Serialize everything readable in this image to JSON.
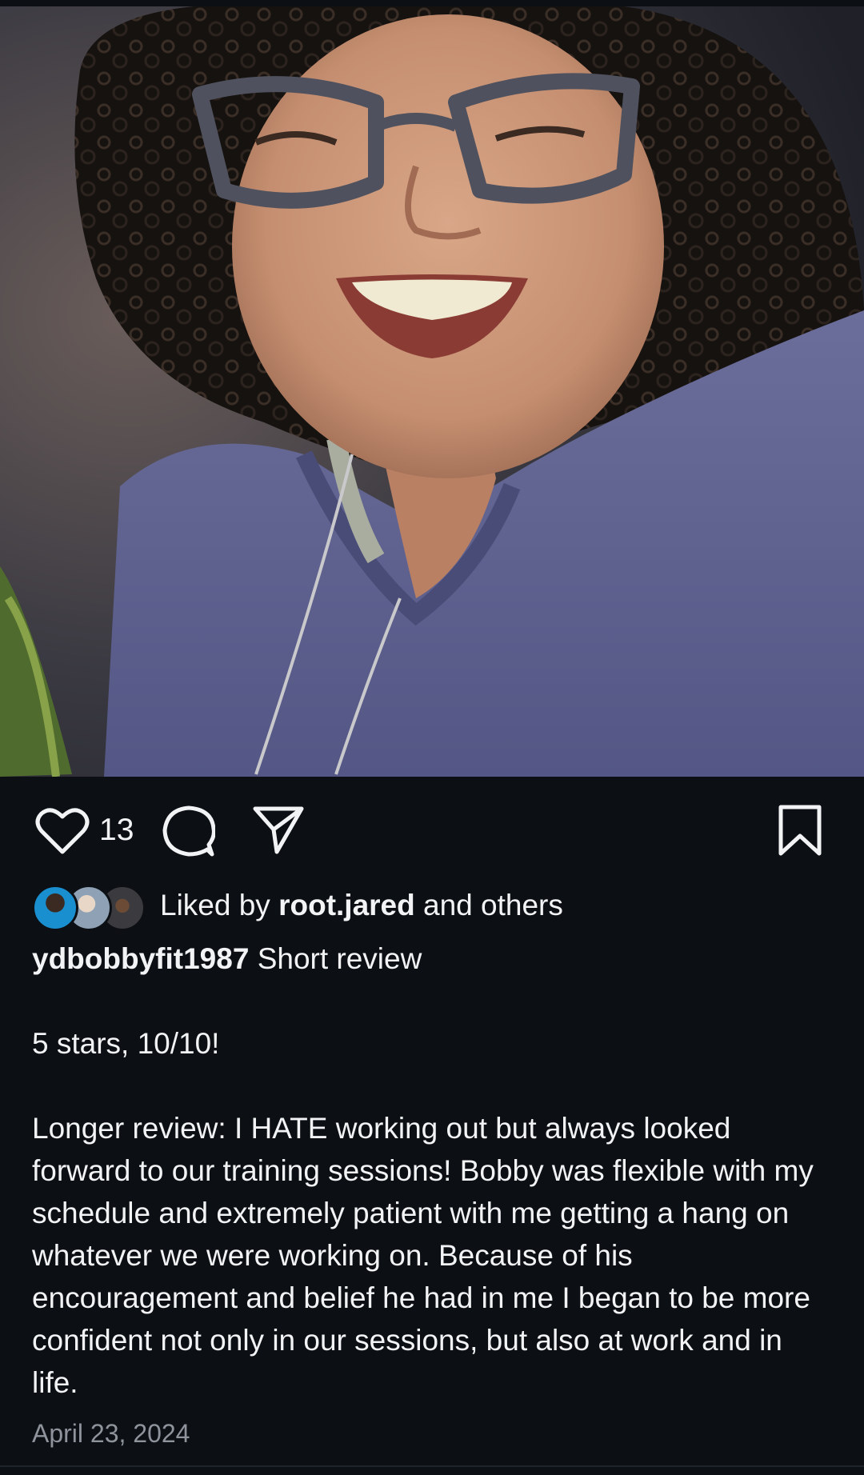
{
  "post": {
    "image_alt": "Smiling woman with curly dark hair and glasses wearing a purple sweatshirt",
    "actions": {
      "like_count": "13",
      "like_icon": "heart-outline-icon",
      "comment_icon": "comment-bubble-icon",
      "share_icon": "paper-plane-icon",
      "save_icon": "bookmark-icon"
    },
    "liked_by": {
      "prefix": "Liked by ",
      "user": "root.jared",
      "suffix": " and others"
    },
    "caption": {
      "username": "ydbobbyfit1987",
      "title": "Short review",
      "line1": "5 stars, 10/10!",
      "body": "Longer review: I HATE working out but always looked forward to our training sessions! Bobby was flexible with my schedule and extremely patient with me getting a hang on whatever we were working on. Because of his encouragement and belief he had in me I began to be more confident not only in our sessions, but also at work and in life."
    },
    "date": "April 23, 2024"
  },
  "colors": {
    "background": "#0c0f14",
    "text": "#f2f3f5",
    "muted": "#8e939c"
  }
}
